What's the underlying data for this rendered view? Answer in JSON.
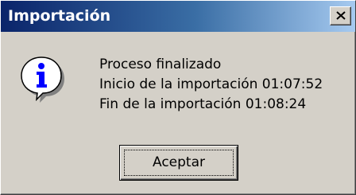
{
  "window": {
    "title": "Importación",
    "close_icon": "close-icon"
  },
  "dialog": {
    "icon": "info-icon",
    "lines": [
      "Proceso finalizado",
      "Inicio de la importación 01:07:52",
      "Fin de la importación 01:08:24"
    ],
    "ok_label": "Aceptar"
  },
  "colors": {
    "titlebar_start": "#0a246a",
    "titlebar_end": "#a6caf0",
    "face": "#d4d0c8",
    "icon_blue": "#0000ff"
  }
}
